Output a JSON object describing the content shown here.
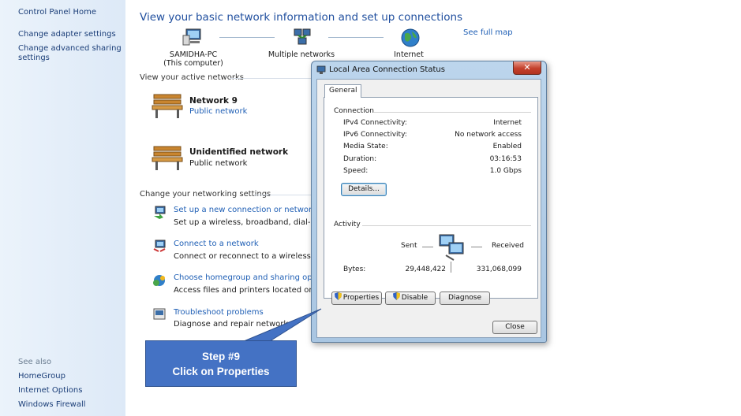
{
  "left_pane": {
    "home": "Control Panel Home",
    "links": [
      "Change adapter settings",
      "Change advanced sharing",
      "settings"
    ],
    "see_also_header": "See also",
    "see_also": [
      "HomeGroup",
      "Internet Options",
      "Windows Firewall"
    ]
  },
  "main": {
    "title": "View your basic network information and set up connections",
    "see_full_map": "See full map",
    "map": {
      "computer_name": "SAMIDHA-PC",
      "computer_sub": "(This computer)",
      "middle": "Multiple networks",
      "internet": "Internet"
    },
    "active_networks_label": "View your active networks",
    "networks": [
      {
        "name": "Network  9",
        "type": "Public network"
      },
      {
        "name": "Unidentified network",
        "type": "Public network"
      }
    ],
    "change_settings_label": "Change your networking settings",
    "tasks": [
      {
        "title": "Set up a new connection or network",
        "desc": "Set up a wireless, broadband, dial-up, ad"
      },
      {
        "title": "Connect to a network",
        "desc": "Connect or reconnect to a wireless, wired"
      },
      {
        "title": "Choose homegroup and sharing options",
        "desc": "Access files and printers located on other"
      },
      {
        "title": "Troubleshoot problems",
        "desc": "Diagnose and repair network p"
      }
    ]
  },
  "dialog": {
    "title": "Local Area Connection Status",
    "close_glyph": "✕",
    "tab": "General",
    "connection_label": "Connection",
    "rows": [
      {
        "k": "IPv4 Connectivity:",
        "v": "Internet"
      },
      {
        "k": "IPv6 Connectivity:",
        "v": "No network access"
      },
      {
        "k": "Media State:",
        "v": "Enabled"
      },
      {
        "k": "Duration:",
        "v": "03:16:53"
      },
      {
        "k": "Speed:",
        "v": "1.0 Gbps"
      }
    ],
    "details_button": "Details...",
    "activity_label": "Activity",
    "sent_label": "Sent",
    "received_label": "Received",
    "bytes_label": "Bytes:",
    "bytes_sent": "29,448,422",
    "bytes_received": "331,068,099",
    "properties_button": "Properties",
    "disable_button": "Disable",
    "diagnose_button": "Diagnose",
    "close_button": "Close"
  },
  "callout": {
    "line1": "Step #9",
    "line2": "Click on Properties",
    "color": "#4472c4"
  }
}
